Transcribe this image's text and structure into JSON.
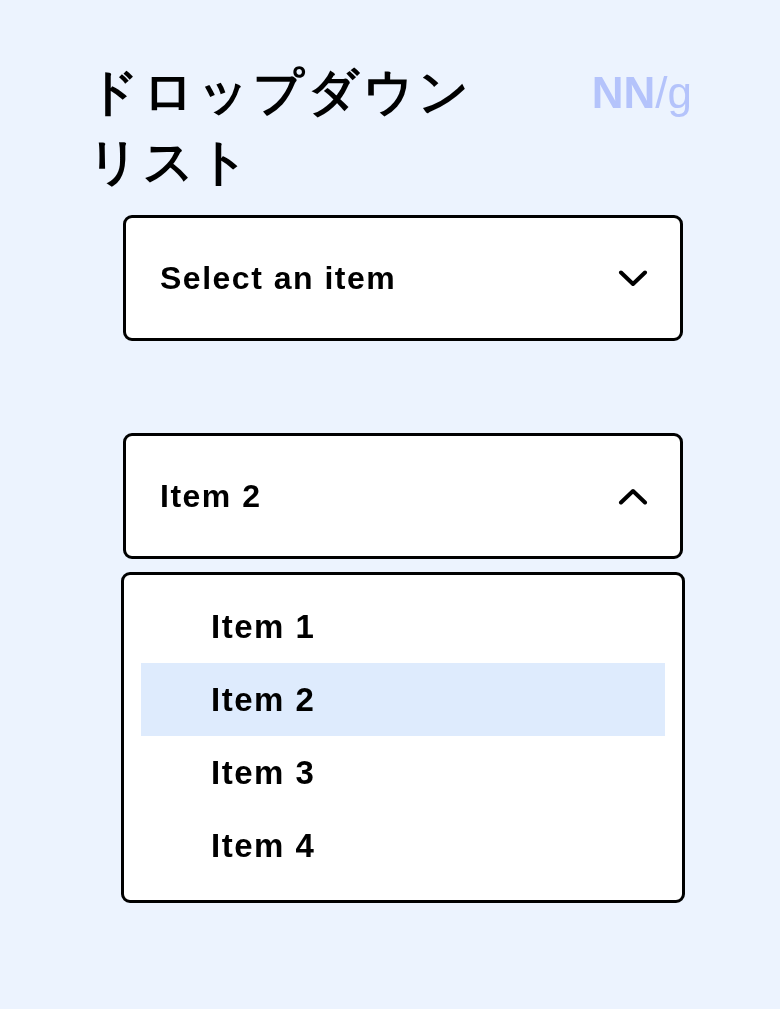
{
  "title": "ドロップダウンリスト",
  "logo": "**NN**/g",
  "dropdowns": [
    {
      "label": "Select an item",
      "expanded": false
    },
    {
      "label": "Item 2",
      "expanded": true,
      "options": [
        {
          "label": "Item 1",
          "selected": false
        },
        {
          "label": "Item 2",
          "selected": true
        },
        {
          "label": "Item 3",
          "selected": false
        },
        {
          "label": "Item 4",
          "selected": false
        }
      ]
    }
  ]
}
